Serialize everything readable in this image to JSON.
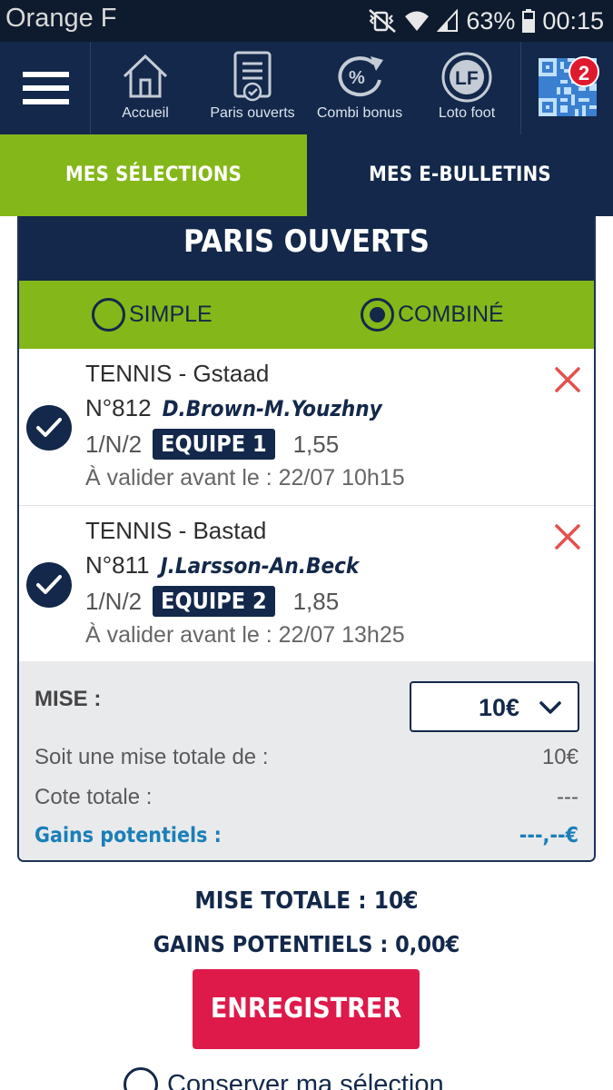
{
  "status_bar": {
    "carrier": "Orange F",
    "battery": "63%",
    "time": "00:15"
  },
  "nav": {
    "items": [
      {
        "label": "Accueil",
        "icon": "home-icon"
      },
      {
        "label": "Paris ouverts",
        "icon": "bet-slip-icon"
      },
      {
        "label": "Combi bonus",
        "icon": "percent-icon"
      },
      {
        "label": "Loto foot",
        "icon": "lf-icon"
      }
    ],
    "qr_badge": "2"
  },
  "tabs": {
    "selections": "MES SÉLECTIONS",
    "ebulletins": "MES E-BULLETINS"
  },
  "card": {
    "title": "PARIS OUVERTS",
    "mode_simple": "SIMPLE",
    "mode_combine": "COMBINÉ",
    "selected_mode": "COMBINÉ"
  },
  "bets": [
    {
      "sport": "TENNIS - Gstaad",
      "number": "N°812",
      "teams": "D.Brown-M.Youzhny",
      "market": "1/N/2",
      "pick": "EQUIPE 1",
      "odds": "1,55",
      "deadline": "À valider avant le : 22/07 10h15"
    },
    {
      "sport": "TENNIS - Bastad",
      "number": "N°811",
      "teams": "J.Larsson-An.Beck",
      "market": "1/N/2",
      "pick": "EQUIPE 2",
      "odds": "1,85",
      "deadline": "À valider avant le : 22/07 13h25"
    }
  ],
  "summary": {
    "mise_label": "MISE :",
    "mise_value": "10€",
    "total_label": "Soit une mise totale de :",
    "total_value": "10€",
    "cote_label": "Cote totale :",
    "cote_value": "---",
    "gains_label": "Gains potentiels :",
    "gains_value": "---,--€"
  },
  "footer": {
    "mise_totale": "MISE TOTALE : 10€",
    "gains_potentiels": "GAINS POTENTIELS : 0,00€",
    "register": "ENREGISTRER",
    "keep_selection": "Conserver ma sélection"
  },
  "colors": {
    "navy": "#13284a",
    "green": "#84b719",
    "red_button": "#dd1a4a",
    "gains_blue": "#1a7fb8"
  }
}
